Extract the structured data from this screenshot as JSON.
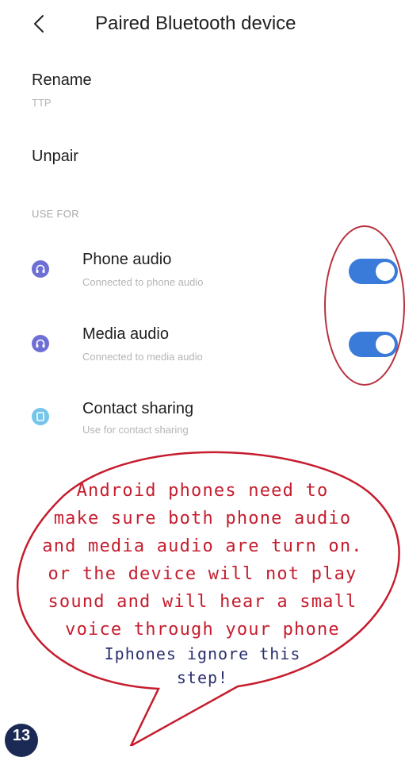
{
  "header": {
    "title": "Paired Bluetooth device",
    "back_icon": "chevron-left-icon"
  },
  "rename": {
    "label": "Rename",
    "value": "TTP"
  },
  "unpair": {
    "label": "Unpair"
  },
  "use_for": {
    "label": "USE FOR",
    "items": [
      {
        "title": "Phone audio",
        "subtitle": "Connected to phone audio",
        "icon": "headset-icon",
        "enabled": true
      },
      {
        "title": "Media audio",
        "subtitle": "Connected to media audio",
        "icon": "headset-icon",
        "enabled": true
      },
      {
        "title": "Contact sharing",
        "subtitle": "Use for contact sharing",
        "icon": "contact-icon"
      }
    ]
  },
  "annotation": {
    "lines": [
      "Android phones need to",
      "make sure both phone audio",
      "and media audio are turn on.",
      "or the device will not play",
      "sound and will hear a small",
      "voice through your phone"
    ],
    "iphone_lines": [
      "Iphones ignore this",
      "step!"
    ],
    "color": "#c51d2e"
  },
  "step_badge": "13",
  "colors": {
    "toggle_on": "#3a7ad8",
    "icon_audio": "#6e6fd4",
    "icon_contact": "#75c5ea"
  }
}
